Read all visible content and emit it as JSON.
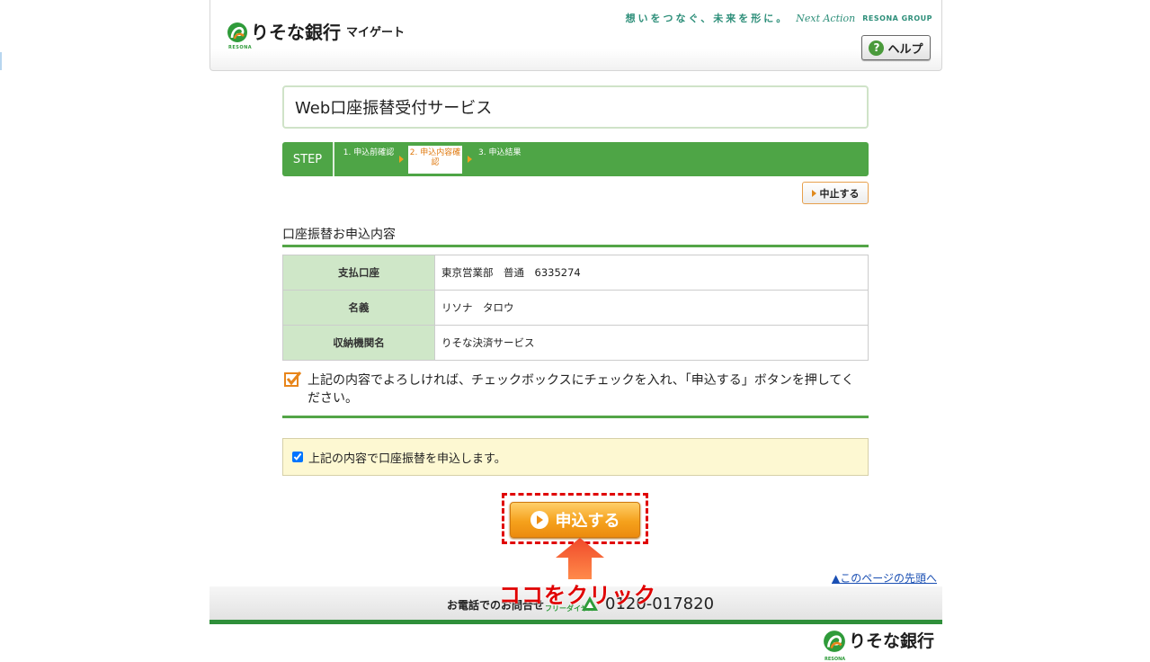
{
  "header": {
    "brand_name": "りそな銀行",
    "brand_sub": "マイゲート",
    "brand_tag": "RESONA",
    "slogan": "想いをつなぐ、未来を形に。",
    "slogan_next": "Next Action",
    "slogan_group": "RESONA GROUP",
    "help_label": "ヘルプ"
  },
  "main": {
    "title": "Web口座振替受付サービス",
    "step": {
      "label": "STEP",
      "steps": [
        "1. 申込前確認",
        "2. 申込内容確認",
        "3. 申込結果"
      ],
      "current": 2
    },
    "cancel_label": "中止する",
    "section_title": "口座振替お申込内容",
    "table": [
      {
        "label": "支払口座",
        "value": "東京営業部　普通　6335274"
      },
      {
        "label": "名義",
        "value": "リソナ　タロウ"
      },
      {
        "label": "収納機関名",
        "value": "りそな決済サービス"
      }
    ],
    "notice": "上記の内容でよろしければ、チェックボックスにチェックを入れ、「申込する」ボタンを押してください。",
    "agree_label": "上記の内容で口座振替を申込します。",
    "agree_checked": true,
    "submit_label": "申込する",
    "annotation": "ココをクリック"
  },
  "footer": {
    "page_top": "▲このページの先頭へ",
    "inquiry": "お電話でのお問合せ",
    "dial": "フリーダイヤル",
    "phone": "0120-017820",
    "brand_name": "りそな銀行",
    "brand_tag": "RESONA"
  },
  "colors": {
    "green": "#4ea546",
    "orange": "#f5a11c",
    "annotation_red": "#e00000"
  }
}
